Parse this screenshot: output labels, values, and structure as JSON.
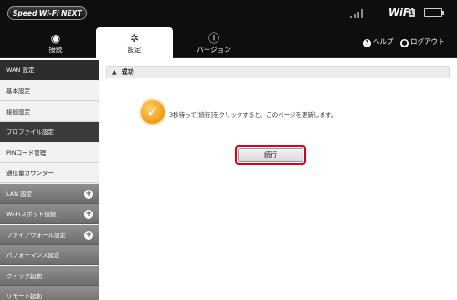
{
  "brand": "Speed Wi-Fi NEXT",
  "status": {
    "wifi_label": "WiFi",
    "wifi_sub": "1"
  },
  "nav": {
    "tabs": [
      {
        "label": "接続",
        "icon": "wifi-icon"
      },
      {
        "label": "設定",
        "icon": "gear-icon"
      },
      {
        "label": "バージョン",
        "icon": "info-icon"
      }
    ],
    "help": "ヘルプ",
    "logout": "ログアウト"
  },
  "sidebar": {
    "items": [
      {
        "label": "WAN 設定",
        "kind": "header"
      },
      {
        "label": "基本設定",
        "kind": "sub"
      },
      {
        "label": "接続設定",
        "kind": "sub"
      },
      {
        "label": "プロファイル設定",
        "kind": "selected"
      },
      {
        "label": "PINコード管理",
        "kind": "sub"
      },
      {
        "label": "通信量カウンター",
        "kind": "sub"
      },
      {
        "label": "LAN 設定",
        "kind": "group",
        "expandable": true
      },
      {
        "label": "Wi-Fiスポット接続",
        "kind": "group",
        "expandable": true
      },
      {
        "label": "ファイアウォール設定",
        "kind": "group",
        "expandable": true
      },
      {
        "label": "パフォーマンス設定",
        "kind": "group"
      },
      {
        "label": "クイック起動",
        "kind": "group"
      },
      {
        "label": "リモート起動",
        "kind": "group"
      }
    ]
  },
  "main": {
    "section_title": "成功",
    "message": "3秒待って[続行]をクリックすると、このページを更新します。",
    "continue_label": "続行"
  },
  "colors": {
    "accent_red": "#d9001b",
    "success_orange": "#f09a16",
    "topbar": "#0e0e0e"
  }
}
